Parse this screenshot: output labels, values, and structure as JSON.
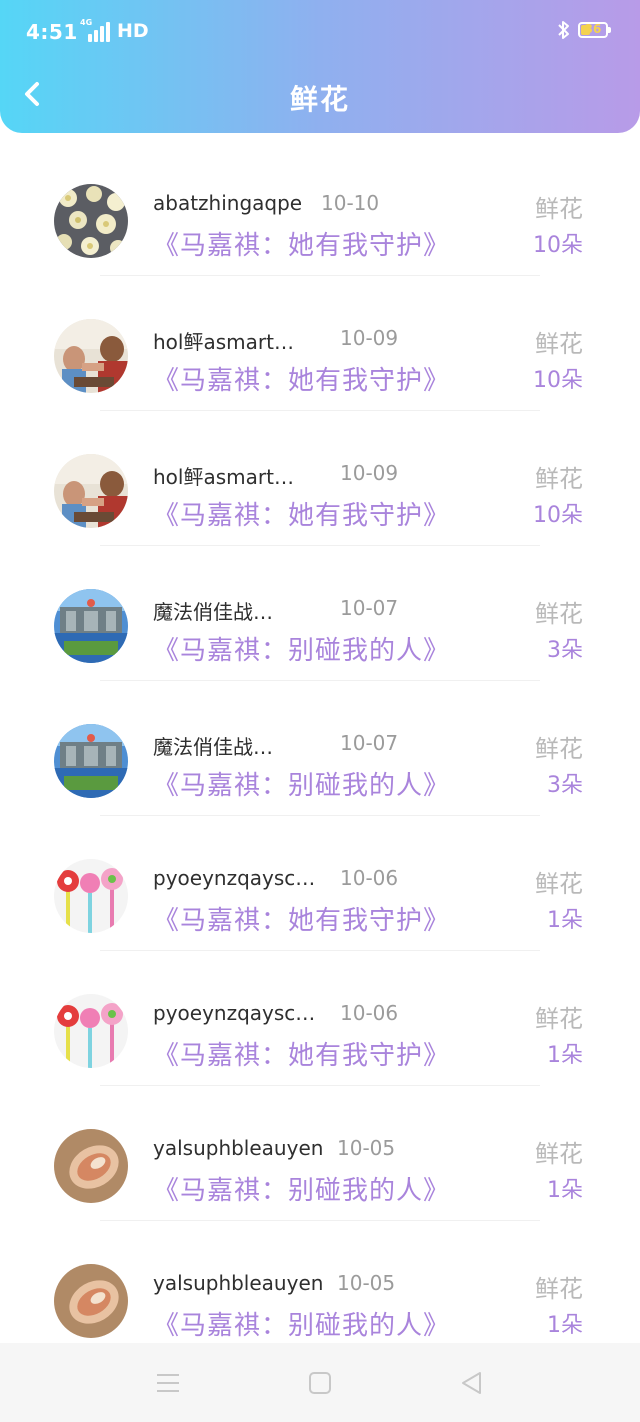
{
  "status_bar": {
    "time": "4:51",
    "network": "4G",
    "hd": "HD",
    "battery": "36"
  },
  "header": {
    "title": "鲜花",
    "back_icon": "chevron-left-icon"
  },
  "colors": {
    "header_gradient": [
      "#55d6f6",
      "#b89be8"
    ],
    "accent": "#a984dc"
  },
  "items": [
    {
      "name": "abatzhingaqpe",
      "date": "10-10",
      "label": "鲜花",
      "work": "《马嘉祺：她有我守护》",
      "count": "10朵",
      "avatar": "floral-pattern"
    },
    {
      "name": "hol鲆asmart…",
      "date": "10-09",
      "label": "鲜花",
      "work": "《马嘉祺：她有我守护》",
      "count": "10朵",
      "avatar": "arm-wrestling"
    },
    {
      "name": "hol鲆asmart…",
      "date": "10-09",
      "label": "鲜花",
      "work": "《马嘉祺：她有我守护》",
      "count": "10朵",
      "avatar": "arm-wrestling"
    },
    {
      "name": "魔法俏佳战…",
      "date": "10-07",
      "label": "鲜花",
      "work": "《马嘉祺：别碰我的人》",
      "count": "3朵",
      "avatar": "temple-landscape"
    },
    {
      "name": "魔法俏佳战…",
      "date": "10-07",
      "label": "鲜花",
      "work": "《马嘉祺：别碰我的人》",
      "count": "3朵",
      "avatar": "temple-landscape"
    },
    {
      "name": "pyoeynzqaysc…",
      "date": "10-06",
      "label": "鲜花",
      "work": "《马嘉祺：她有我守护》",
      "count": "1朵",
      "avatar": "lollipops"
    },
    {
      "name": "pyoeynzqaysc…",
      "date": "10-06",
      "label": "鲜花",
      "work": "《马嘉祺：她有我守护》",
      "count": "1朵",
      "avatar": "lollipops"
    },
    {
      "name": "yalsuphbleauyen",
      "date": "10-05",
      "label": "鲜花",
      "work": "《马嘉祺：别碰我的人》",
      "count": "1朵",
      "avatar": "seashell"
    },
    {
      "name": "yalsuphbleauyen",
      "date": "10-05",
      "label": "鲜花",
      "work": "《马嘉祺：别碰我的人》",
      "count": "1朵",
      "avatar": "seashell"
    }
  ],
  "navbar": {
    "menu_icon": "menu-icon",
    "home_icon": "home-square-icon",
    "back_icon": "back-triangle-icon"
  }
}
